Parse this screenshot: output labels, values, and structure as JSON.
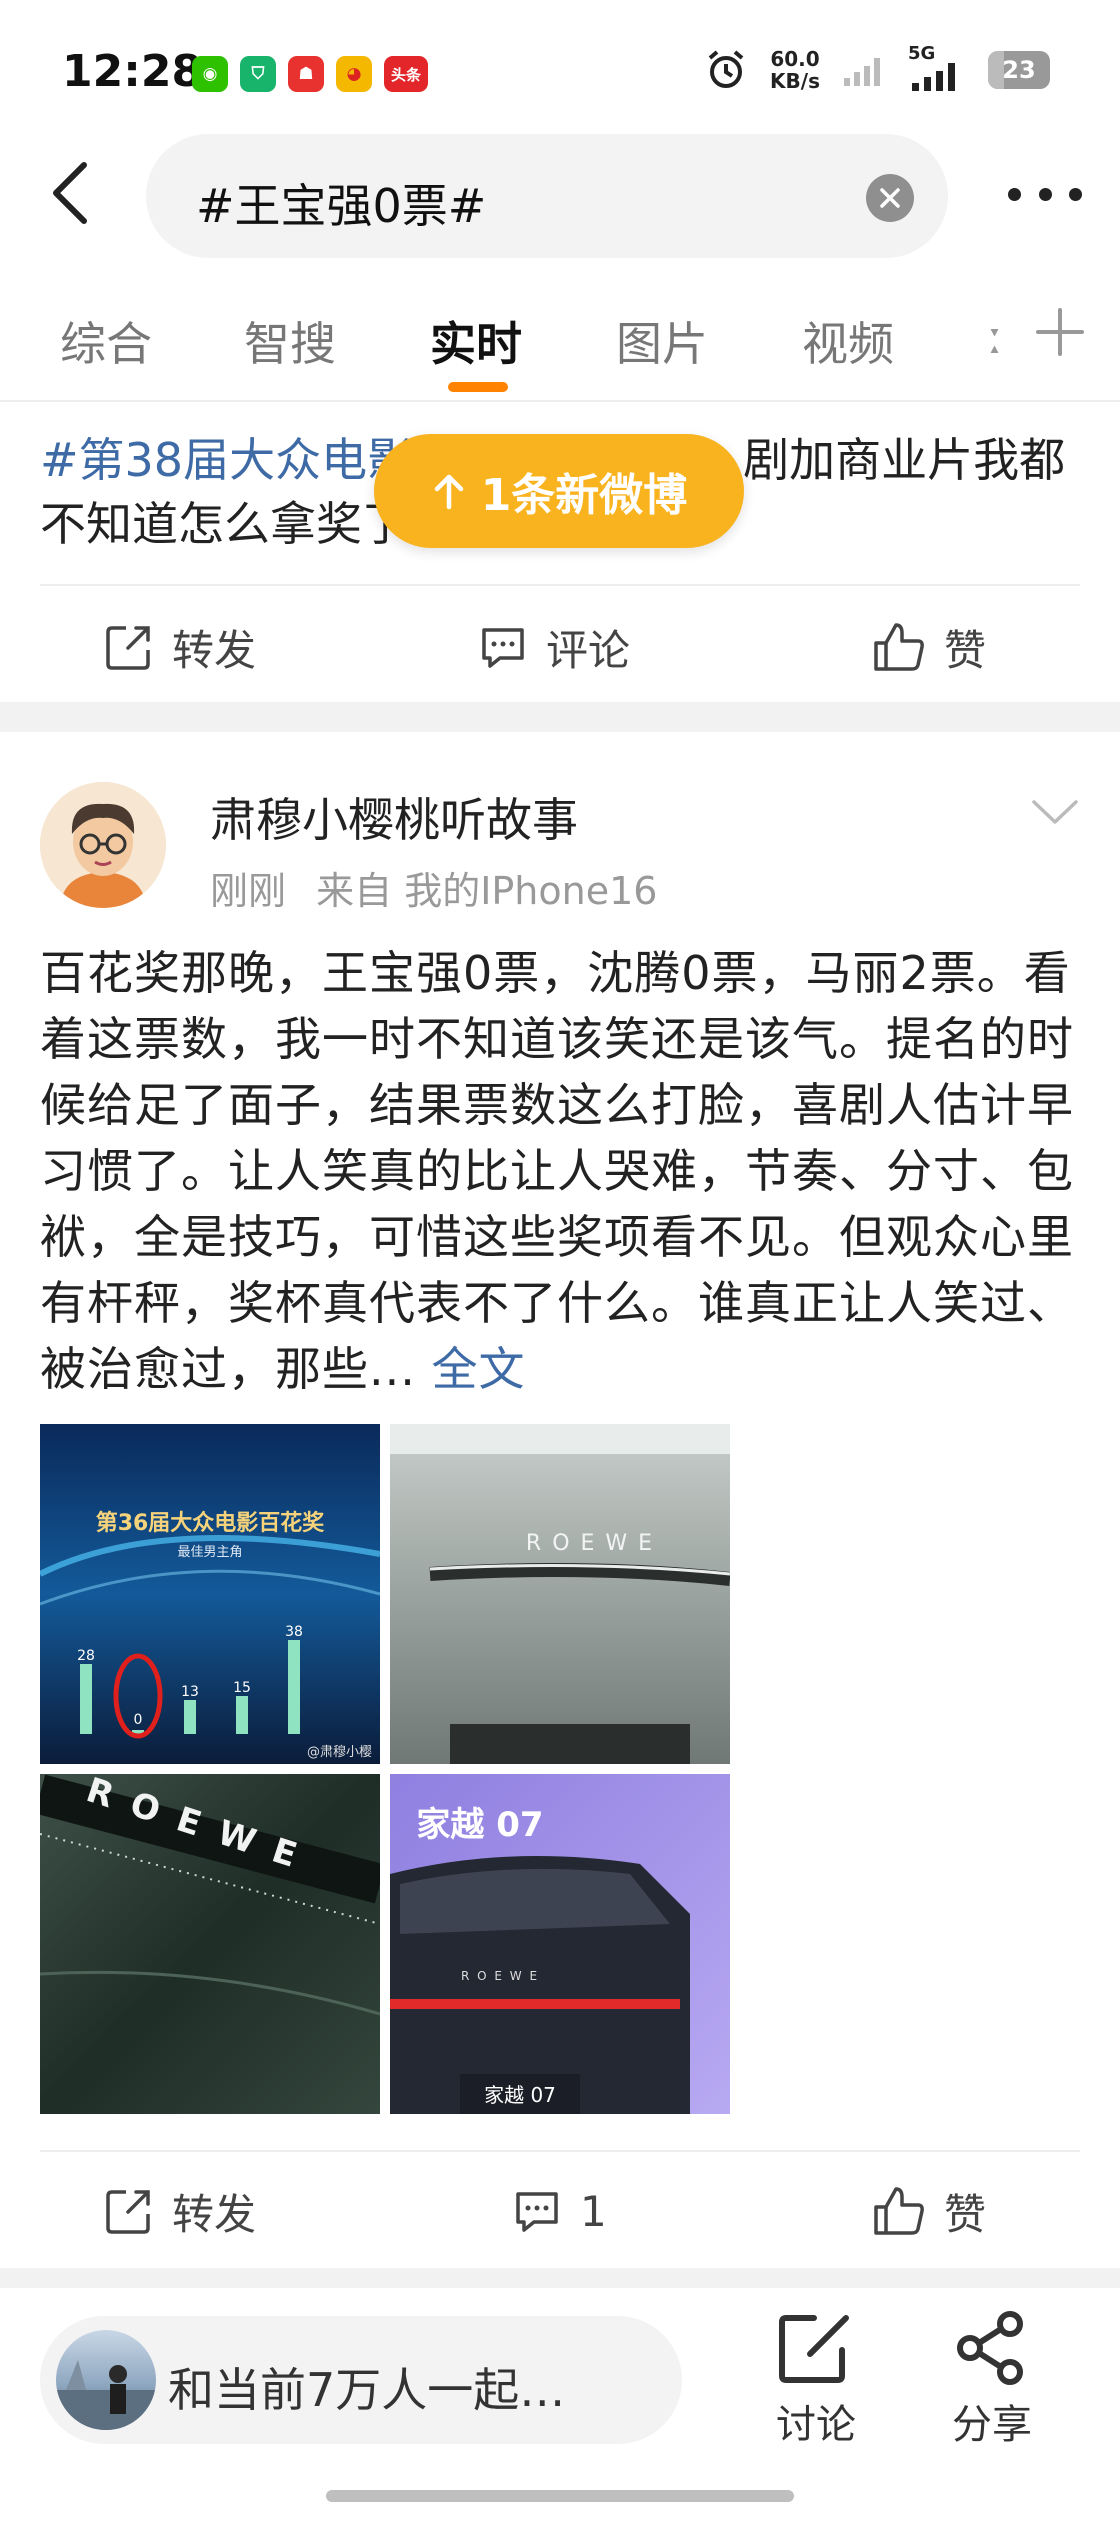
{
  "status_bar": {
    "time": "12:28",
    "apps": [
      {
        "icon": "wechat-icon",
        "color": "#2dc100",
        "glyph": "◉"
      },
      {
        "icon": "shield-app-icon",
        "color": "#18b46b",
        "glyph": "⛉"
      },
      {
        "icon": "red-app-icon",
        "color": "#e8322f",
        "glyph": "☗"
      },
      {
        "icon": "weibo-icon",
        "color": "#f5b800",
        "glyph": "◕"
      },
      {
        "icon": "toutiao-icon",
        "color": "#e2262a",
        "glyph": "头条"
      }
    ],
    "net_speed_value": "60.0",
    "net_speed_unit": "KB/s",
    "network": "5G",
    "battery": "23"
  },
  "search": {
    "query": "#王宝强0票#"
  },
  "tabs": [
    {
      "label": "综合"
    },
    {
      "label": "智搜"
    },
    {
      "label": "实时"
    },
    {
      "label": "图片"
    },
    {
      "label": "视频"
    }
  ],
  "tab_active_index": 2,
  "tab_overflow_text": "ː",
  "new_posts_pill": {
    "label": "1条新微博"
  },
  "post1": {
    "topic": "#第38届大众电影",
    "text_line1_tail": "剧加商业片我都",
    "text_line2": "不知道怎么拿奖了",
    "actions": {
      "repost": "转发",
      "comment": "评论",
      "like": "赞"
    }
  },
  "post2": {
    "author": "肃穆小樱桃听故事",
    "time": "刚刚",
    "source": "来自 我的IPhone16",
    "body": "百花奖那晚，王宝强0票，沈腾0票，马丽2票。看着这票数，我一时不知道该笑还是该气。提名的时候给足了面子，结果票数这么打脸，喜剧人估计早习惯了。让人笑真的比让人哭难，节奏、分寸、包袱，全是技巧，可惜这些奖项看不见。但观众心里有杆秤，奖杯真代表不了什么。谁真正让人笑过、被治愈过，那些...",
    "full_text_link": "全文",
    "images": [
      {
        "caption": "第36届大众电影百花奖",
        "subcaption": "最佳男主角",
        "bar_values": [
          "28",
          "0",
          "13",
          "15",
          "38"
        ],
        "watermark": "@肃穆小樱"
      },
      {
        "brand": "R O E W E"
      },
      {
        "brand": "R O E W E"
      },
      {
        "title": "家越 07",
        "plate": "家越 07",
        "brand": "R O E W E"
      }
    ],
    "actions": {
      "repost": "转发",
      "comment_count": "1",
      "like": "赞"
    }
  },
  "bottom_bar": {
    "prompt": "和当前7万人一起…",
    "discuss": "讨论",
    "share": "分享"
  }
}
